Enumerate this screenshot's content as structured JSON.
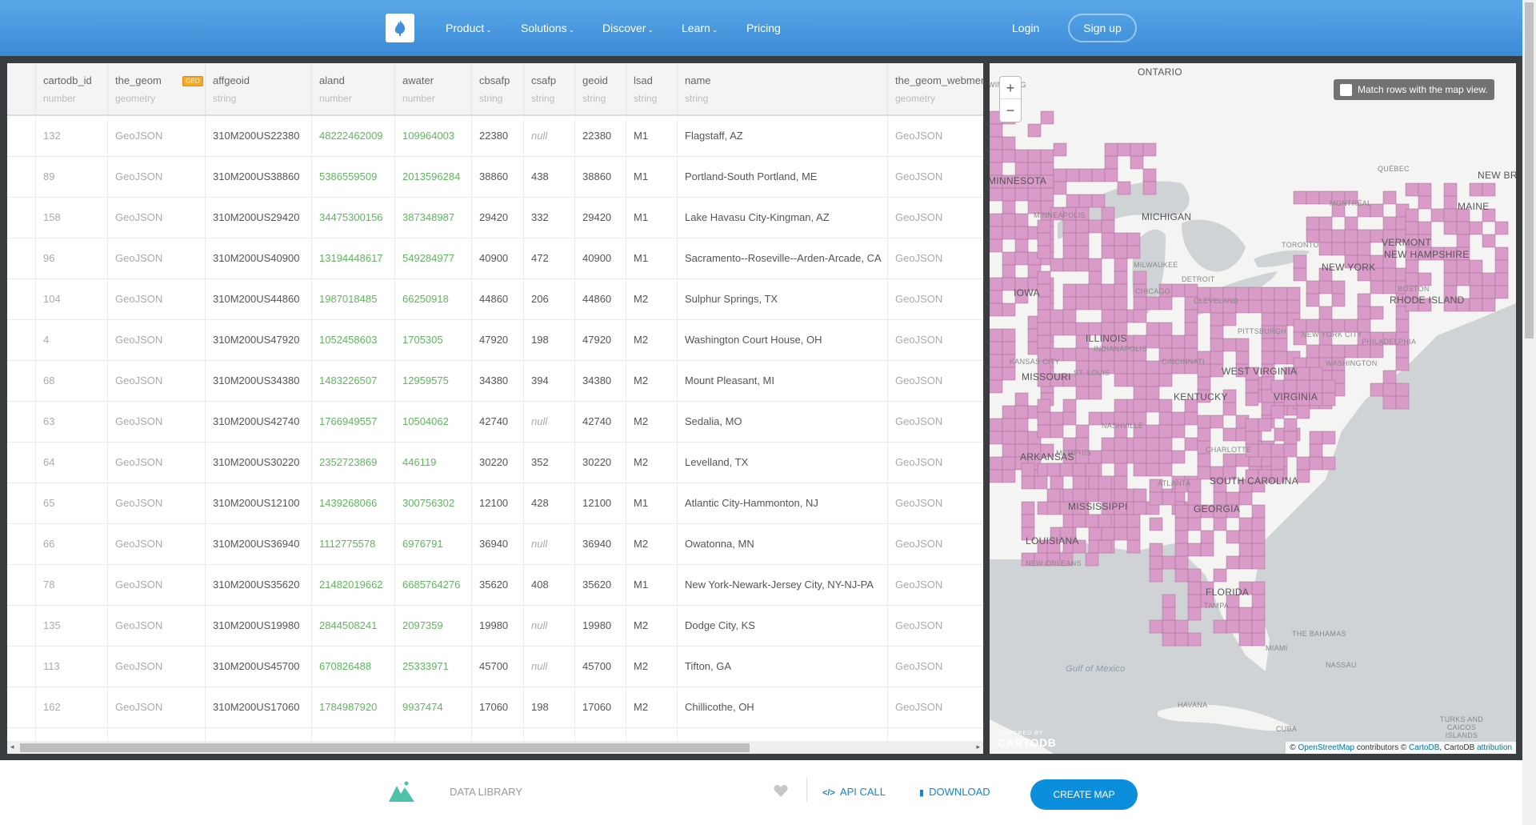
{
  "header": {
    "logo_icon": "cartodb-flame-icon",
    "nav": [
      {
        "label": "Product",
        "dropdown": true
      },
      {
        "label": "Solutions",
        "dropdown": true
      },
      {
        "label": "Discover",
        "dropdown": true
      },
      {
        "label": "Learn",
        "dropdown": true
      },
      {
        "label": "Pricing",
        "dropdown": false
      }
    ],
    "login": "Login",
    "signup": "Sign up",
    "chevron_glyph": "⌄"
  },
  "table": {
    "geo_badge": "GEO",
    "columns": [
      {
        "name": "cartodb_id",
        "type": "number"
      },
      {
        "name": "the_geom",
        "type": "geometry"
      },
      {
        "name": "affgeoid",
        "type": "string"
      },
      {
        "name": "aland",
        "type": "number"
      },
      {
        "name": "awater",
        "type": "number"
      },
      {
        "name": "cbsafp",
        "type": "string"
      },
      {
        "name": "csafp",
        "type": "string"
      },
      {
        "name": "geoid",
        "type": "string"
      },
      {
        "name": "lsad",
        "type": "string"
      },
      {
        "name": "name",
        "type": "string"
      },
      {
        "name": "the_geom_webmercator",
        "type": "geometry"
      }
    ],
    "rows": [
      [
        "132",
        "GeoJSON",
        "310M200US22380",
        "48222462009",
        "109964003",
        "22380",
        "null",
        "22380",
        "M1",
        "Flagstaff, AZ",
        "GeoJSON"
      ],
      [
        "89",
        "GeoJSON",
        "310M200US38860",
        "5386559509",
        "2013596284",
        "38860",
        "438",
        "38860",
        "M1",
        "Portland-South Portland, ME",
        "GeoJSON"
      ],
      [
        "158",
        "GeoJSON",
        "310M200US29420",
        "34475300156",
        "387348987",
        "29420",
        "332",
        "29420",
        "M1",
        "Lake Havasu City-Kingman, AZ",
        "GeoJSON"
      ],
      [
        "96",
        "GeoJSON",
        "310M200US40900",
        "13194448617",
        "549284977",
        "40900",
        "472",
        "40900",
        "M1",
        "Sacramento--Roseville--Arden-Arcade, CA",
        "GeoJSON"
      ],
      [
        "104",
        "GeoJSON",
        "310M200US44860",
        "1987018485",
        "66250918",
        "44860",
        "206",
        "44860",
        "M2",
        "Sulphur Springs, TX",
        "GeoJSON"
      ],
      [
        "4",
        "GeoJSON",
        "310M200US47920",
        "1052458603",
        "1705305",
        "47920",
        "198",
        "47920",
        "M2",
        "Washington Court House, OH",
        "GeoJSON"
      ],
      [
        "68",
        "GeoJSON",
        "310M200US34380",
        "1483226507",
        "12959575",
        "34380",
        "394",
        "34380",
        "M2",
        "Mount Pleasant, MI",
        "GeoJSON"
      ],
      [
        "63",
        "GeoJSON",
        "310M200US42740",
        "1766949557",
        "10504062",
        "42740",
        "null",
        "42740",
        "M2",
        "Sedalia, MO",
        "GeoJSON"
      ],
      [
        "64",
        "GeoJSON",
        "310M200US30220",
        "2352723869",
        "446119",
        "30220",
        "352",
        "30220",
        "M2",
        "Levelland, TX",
        "GeoJSON"
      ],
      [
        "65",
        "GeoJSON",
        "310M200US12100",
        "1439268066",
        "300756302",
        "12100",
        "428",
        "12100",
        "M1",
        "Atlantic City-Hammonton, NJ",
        "GeoJSON"
      ],
      [
        "66",
        "GeoJSON",
        "310M200US36940",
        "1112775578",
        "6976791",
        "36940",
        "null",
        "36940",
        "M2",
        "Owatonna, MN",
        "GeoJSON"
      ],
      [
        "78",
        "GeoJSON",
        "310M200US35620",
        "21482019662",
        "6685764276",
        "35620",
        "408",
        "35620",
        "M1",
        "New York-Newark-Jersey City, NY-NJ-PA",
        "GeoJSON"
      ],
      [
        "135",
        "GeoJSON",
        "310M200US19980",
        "2844508241",
        "2097359",
        "19980",
        "null",
        "19980",
        "M2",
        "Dodge City, KS",
        "GeoJSON"
      ],
      [
        "113",
        "GeoJSON",
        "310M200US45700",
        "670826488",
        "25333971",
        "45700",
        "null",
        "45700",
        "M2",
        "Tifton, GA",
        "GeoJSON"
      ],
      [
        "162",
        "GeoJSON",
        "310M200US17060",
        "1784987920",
        "9937474",
        "17060",
        "198",
        "17060",
        "M2",
        "Chillicothe, OH",
        "GeoJSON"
      ]
    ],
    "scroll_left_glyph": "◂",
    "scroll_right_glyph": "▸"
  },
  "map": {
    "zoom_in": "+",
    "zoom_out": "−",
    "match_rows_label": "Match rows with the map view.",
    "match_rows_checked": false,
    "fill_color": "#d99bc8",
    "labels": [
      {
        "text": "ONTARIO",
        "cls": ""
      },
      {
        "text": "MINNESOTA",
        "cls": ""
      },
      {
        "text": "MINNEAPOLIS",
        "cls": "small"
      },
      {
        "text": "MICHIGAN",
        "cls": ""
      },
      {
        "text": "MILWAUKEE",
        "cls": "small"
      },
      {
        "text": "CHICAGO",
        "cls": "small"
      },
      {
        "text": "DETROIT",
        "cls": "small"
      },
      {
        "text": "CLEVELAND",
        "cls": "small"
      },
      {
        "text": "IOWA",
        "cls": ""
      },
      {
        "text": "ILLINOIS",
        "cls": ""
      },
      {
        "text": "INDIANAPOLIS",
        "cls": "small"
      },
      {
        "text": "KANSAS CITY",
        "cls": "small"
      },
      {
        "text": "MISSOURI",
        "cls": ""
      },
      {
        "text": "ST. LOUIS",
        "cls": "small"
      },
      {
        "text": "PITTSBURGH",
        "cls": "small"
      },
      {
        "text": "CINCINNATI",
        "cls": "small"
      },
      {
        "text": "WEST VIRGINIA",
        "cls": ""
      },
      {
        "text": "KENTUCKY",
        "cls": ""
      },
      {
        "text": "VIRGINIA",
        "cls": ""
      },
      {
        "text": "WASHINGTON",
        "cls": "small"
      },
      {
        "text": "NASHVILLE",
        "cls": "small"
      },
      {
        "text": "MEMPHIS",
        "cls": "small"
      },
      {
        "text": "ARKANSAS",
        "cls": ""
      },
      {
        "text": "CHARLOTTE",
        "cls": "small"
      },
      {
        "text": "ATLANTA",
        "cls": "small"
      },
      {
        "text": "SOUTH CAROLINA",
        "cls": ""
      },
      {
        "text": "MISSISSIPPI",
        "cls": ""
      },
      {
        "text": "GEORGIA",
        "cls": ""
      },
      {
        "text": "LOUISIANA",
        "cls": ""
      },
      {
        "text": "NEW ORLEANS",
        "cls": "small"
      },
      {
        "text": "FLORIDA",
        "cls": ""
      },
      {
        "text": "TAMPA",
        "cls": "small"
      },
      {
        "text": "MIAMI",
        "cls": "small"
      },
      {
        "text": "Gulf of Mexico",
        "cls": "water"
      },
      {
        "text": "THE BAHAMAS",
        "cls": "small"
      },
      {
        "text": "NASSAU",
        "cls": "small"
      },
      {
        "text": "HAVANA",
        "cls": "small"
      },
      {
        "text": "CUBA",
        "cls": "small"
      },
      {
        "text": "TURKS AND CAICOS ISLANDS",
        "cls": "small"
      },
      {
        "text": "QUÉBEC",
        "cls": "small"
      },
      {
        "text": "NEW BR",
        "cls": ""
      },
      {
        "text": "MONTRÉAL",
        "cls": "small"
      },
      {
        "text": "MAINE",
        "cls": ""
      },
      {
        "text": "TORONTO",
        "cls": "small"
      },
      {
        "text": "VERMONT",
        "cls": ""
      },
      {
        "text": "NEW HAMPSHIRE",
        "cls": ""
      },
      {
        "text": "NEW YORK",
        "cls": ""
      },
      {
        "text": "BOSTON",
        "cls": "small"
      },
      {
        "text": "RHODE ISLAND",
        "cls": ""
      },
      {
        "text": "NEW YORK CITY",
        "cls": "small"
      },
      {
        "text": "PHILADELPHIA",
        "cls": "small"
      },
      {
        "text": "WINNIPEG",
        "cls": "small"
      }
    ],
    "powered_by": "POWERED BY",
    "powered_brand": "CARTODB",
    "attribution": {
      "prefix": "©",
      "osm": "OpenStreetMap",
      "contributors": "contributors ©",
      "cartodb": "CartoDB",
      "middle": ", CartoDB",
      "attribution": "attribution"
    }
  },
  "footer": {
    "library_icon": "mountains-icon",
    "library_label": "DATA LIBRARY",
    "like_icon": "heart-icon",
    "api_icon_glyph": "</>",
    "api_label": "API CALL",
    "download_icon_glyph": "▮",
    "download_label": "DOWNLOAD",
    "create_map": "CREATE MAP"
  }
}
